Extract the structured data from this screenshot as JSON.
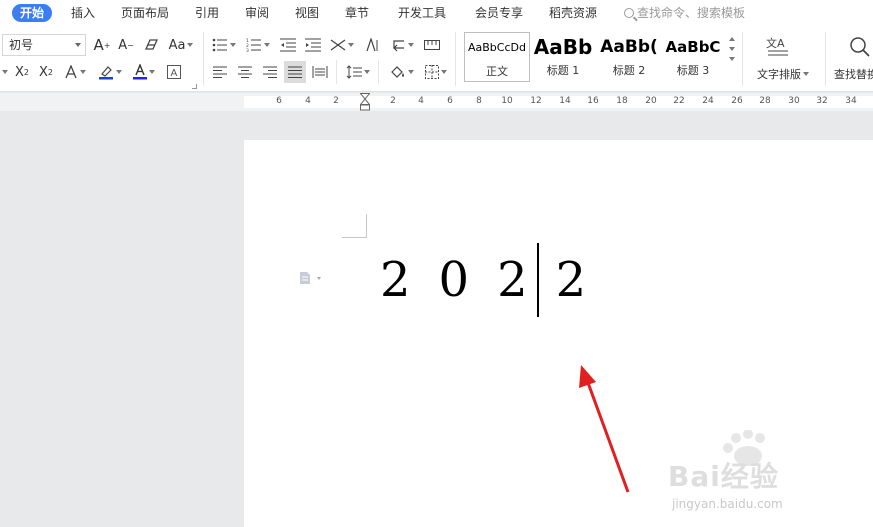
{
  "menu": {
    "tabs": [
      {
        "label": "开始",
        "active": true
      },
      {
        "label": "插入"
      },
      {
        "label": "页面布局"
      },
      {
        "label": "引用"
      },
      {
        "label": "审阅"
      },
      {
        "label": "视图"
      },
      {
        "label": "章节"
      },
      {
        "label": "开发工具"
      },
      {
        "label": "会员专享"
      },
      {
        "label": "稻壳资源"
      }
    ],
    "search_placeholder": "查找命令、搜索模板"
  },
  "ribbon": {
    "font_size_value": "初号",
    "styles": [
      {
        "sample": "AaBbCcDd",
        "label": "正文"
      },
      {
        "sample": "AaBb",
        "label": "标题 1"
      },
      {
        "sample": "AaBb(",
        "label": "标题 2"
      },
      {
        "sample": "AaBbC",
        "label": "标题 3"
      }
    ],
    "text_layout_label": "文字排版",
    "find_replace_label": "查找替换"
  },
  "ruler": {
    "left_ticks": [
      "6",
      "4",
      "2"
    ],
    "right_ticks": [
      "2",
      "4",
      "6",
      "8",
      "10",
      "12",
      "14",
      "16",
      "18",
      "20",
      "22",
      "24",
      "26",
      "28",
      "30",
      "32",
      "34"
    ]
  },
  "document": {
    "text": "2022"
  },
  "watermark": {
    "logo": "Bai经验",
    "url": "jingyan.baidu.com"
  },
  "colors": {
    "accent": "#3c7cf5",
    "arrow": "#e02020",
    "font_color_underline": "#1f1fff",
    "highlight_underline": "#1a3fd4"
  }
}
